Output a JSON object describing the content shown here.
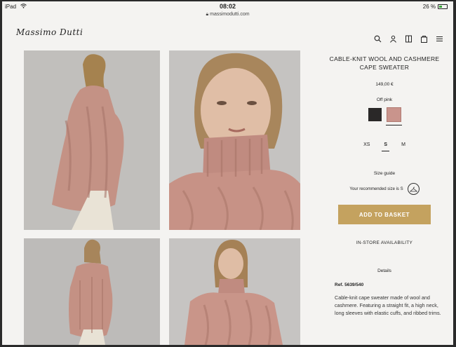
{
  "statusbar": {
    "device": "iPad",
    "time": "08:02",
    "battery": "26 %"
  },
  "browser": {
    "url": "massimodutti.com"
  },
  "header": {
    "logo": "Massimo Dutti",
    "icons": [
      "search-icon",
      "user-icon",
      "bookmark-icon",
      "bag-icon",
      "menu-icon"
    ]
  },
  "product": {
    "title": "CABLE-KNIT WOOL AND CASHMERE CAPE SWEATER",
    "price": "149,00 €",
    "color_label": "Off pink",
    "colors": [
      {
        "name": "black",
        "hex": "#2a2828"
      },
      {
        "name": "off-pink",
        "hex": "#c9948c",
        "selected": true
      }
    ],
    "sizes": [
      "XS",
      "S",
      "M"
    ],
    "selected_size": "S",
    "size_guide": "Size guide",
    "recommended": "Your recommended size is S",
    "add_to_basket": "ADD TO BASKET",
    "in_store": "IN-STORE AVAILABILITY",
    "details_label": "Details",
    "ref": "Ref. 5639/540",
    "description": "Cable-knit cape sweater made of wool and cashmere. Featuring a straight fit, a high neck, long sleeves with elastic cuffs, and ribbed trims."
  },
  "colors": {
    "accent": "#c4a25f",
    "sweater": "#c9948c",
    "background": "#f4f3f1"
  }
}
